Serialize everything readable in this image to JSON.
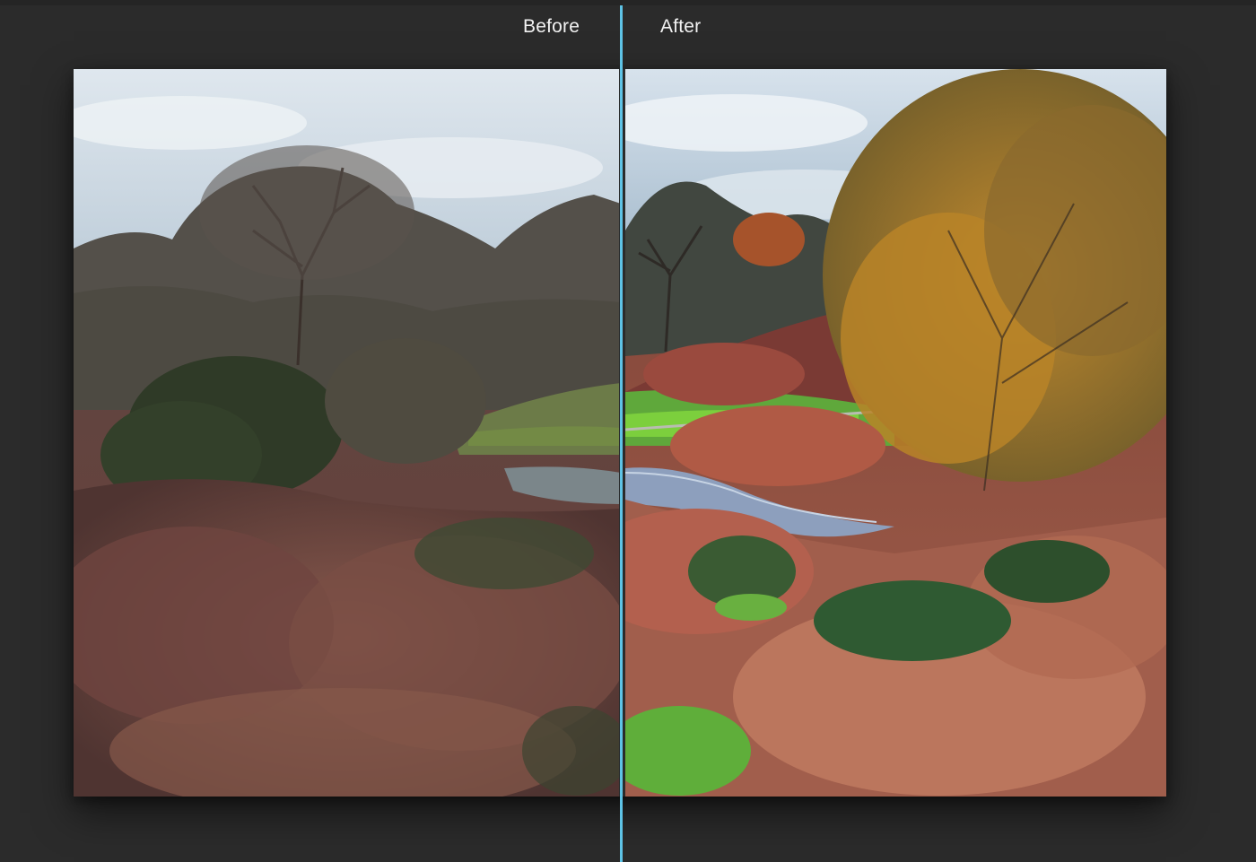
{
  "compare": {
    "before_label": "Before",
    "after_label": "After"
  },
  "colors": {
    "background": "#2b2b2b",
    "divider": "#5ec3e6",
    "label_text": "#f2f2f2"
  }
}
